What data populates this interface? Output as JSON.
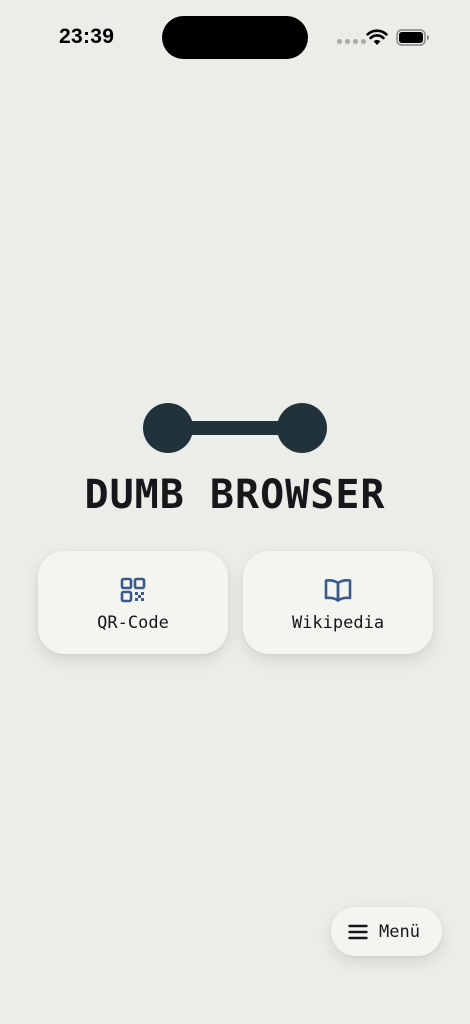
{
  "status_bar": {
    "time": "23:39"
  },
  "app": {
    "title": "DUMB BROWSER"
  },
  "actions": [
    {
      "label": "QR-Code",
      "icon": "qr-code-icon"
    },
    {
      "label": "Wikipedia",
      "icon": "open-book-icon"
    }
  ],
  "menu": {
    "label": "Menü",
    "icon": "hamburger-icon"
  },
  "colors": {
    "background": "#EBEDE8",
    "card": "#F4F5F1",
    "logo": "#22323A",
    "icon_accent": "#3A5A8C",
    "text": "#15171A"
  }
}
